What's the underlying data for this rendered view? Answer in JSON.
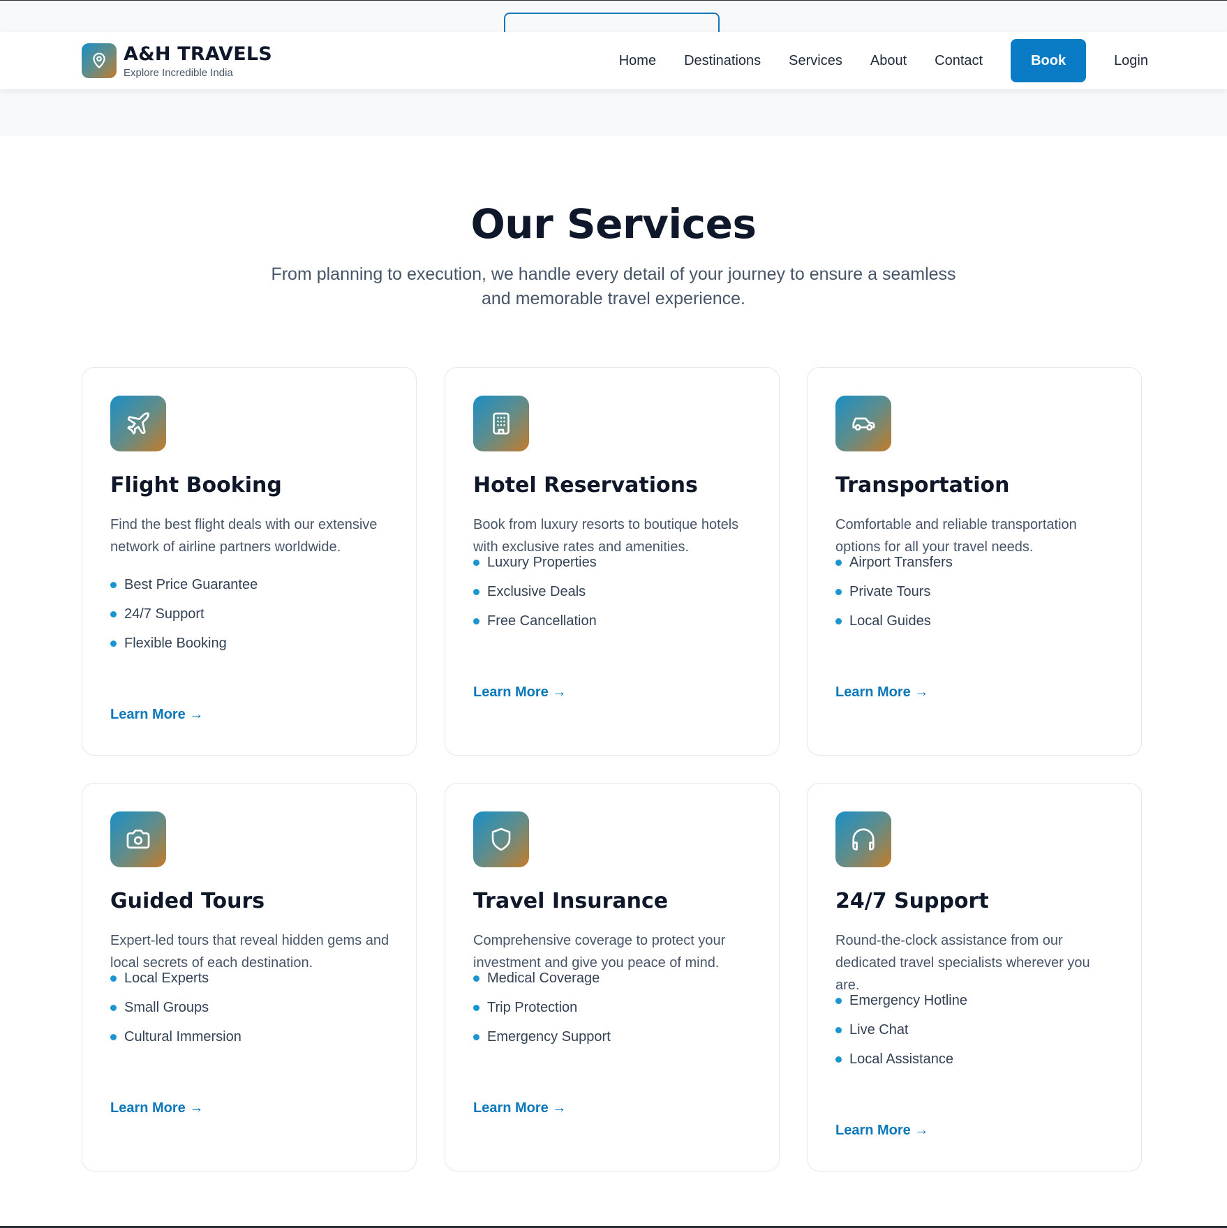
{
  "brand": {
    "name": "A&H TRAVELS",
    "tagline": "Explore Incredible India",
    "icon": "map-pin-icon"
  },
  "nav": {
    "links": [
      "Home",
      "Destinations",
      "Services",
      "About",
      "Contact"
    ],
    "book_label": "Book",
    "login_label": "Login",
    "accent_color": "#0a7cc6"
  },
  "section": {
    "title": "Our Services",
    "subtitle": "From planning to execution, we handle every detail of your journey to ensure a seamless and memorable travel experience."
  },
  "services": [
    {
      "icon": "plane-icon",
      "title": "Flight Booking",
      "description": "Find the best flight deals with our extensive network of airline partners worldwide.",
      "features": [
        "Best Price Guarantee",
        "24/7 Support",
        "Flexible Booking"
      ],
      "link": "Learn More →"
    },
    {
      "icon": "building-icon",
      "title": "Hotel Reservations",
      "description": "Book from luxury resorts to boutique hotels with exclusive rates and amenities.",
      "features": [
        "Luxury Properties",
        "Exclusive Deals",
        "Free Cancellation"
      ],
      "link": "Learn More →"
    },
    {
      "icon": "car-icon",
      "title": "Transportation",
      "description": "Comfortable and reliable transportation options for all your travel needs.",
      "features": [
        "Airport Transfers",
        "Private Tours",
        "Local Guides"
      ],
      "link": "Learn More →"
    },
    {
      "icon": "camera-icon",
      "title": "Guided Tours",
      "description": "Expert-led tours that reveal hidden gems and local secrets of each destination.",
      "features": [
        "Local Experts",
        "Small Groups",
        "Cultural Immersion"
      ],
      "link": "Learn More →"
    },
    {
      "icon": "shield-icon",
      "title": "Travel Insurance",
      "description": "Comprehensive coverage to protect your investment and give you peace of mind.",
      "features": [
        "Medical Coverage",
        "Trip Protection",
        "Emergency Support"
      ],
      "link": "Learn More →"
    },
    {
      "icon": "headphones-icon",
      "title": "24/7 Support",
      "description": "Round-the-clock assistance from our dedicated travel specialists wherever you are.",
      "features": [
        "Emergency Hotline",
        "Live Chat",
        "Local Assistance"
      ],
      "link": "Learn More →"
    }
  ]
}
